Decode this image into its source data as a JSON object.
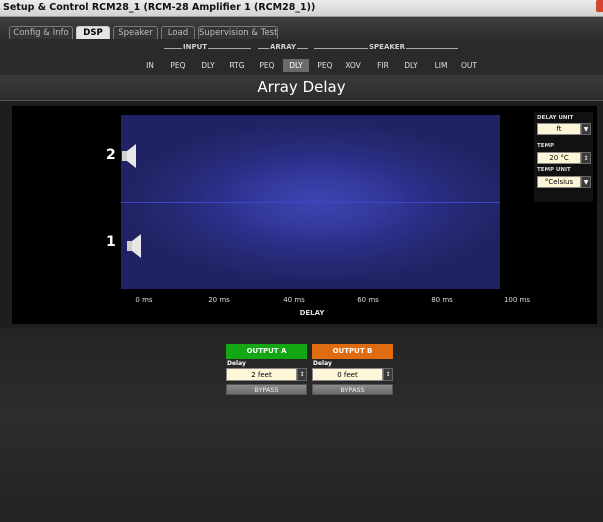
{
  "window": {
    "title": "Setup & Control RCM28_1 (RCM-28 Amplifier 1 (RCM28_1))"
  },
  "tabs": [
    {
      "label": "Config & Info",
      "active": false
    },
    {
      "label": "DSP",
      "active": true
    },
    {
      "label": "Speaker",
      "active": false
    },
    {
      "label": "Load",
      "active": false
    },
    {
      "label": "Supervision & Test",
      "active": false
    }
  ],
  "signal_chain": {
    "groups": {
      "input": "INPUT",
      "array": "ARRAY",
      "speaker": "SPEAKER"
    },
    "stages": [
      "IN",
      "PEQ",
      "DLY",
      "RTG",
      "PEQ",
      "DLY",
      "PEQ",
      "XOV",
      "FIR",
      "DLY",
      "LIM",
      "OUT"
    ],
    "active_index": 5
  },
  "page": {
    "title": "Array Delay"
  },
  "plot": {
    "speaker_labels": [
      "2",
      "1"
    ],
    "x_ticks": [
      "0 ms",
      "20 ms",
      "40 ms",
      "60 ms",
      "80 ms",
      "100 ms"
    ],
    "x_label": "DELAY",
    "colors": {
      "field": "#2a2e86",
      "center_line": "#3a48c8"
    }
  },
  "side_panel": {
    "delay_unit_label": "DELAY UNIT",
    "delay_unit_value": "ft",
    "temp_label": "TEMP",
    "temp_value": "20 °C",
    "temp_unit_label": "TEMP UNIT",
    "temp_unit_value": "°Celsius"
  },
  "outputs": [
    {
      "name": "OUTPUT A",
      "delay_label": "Delay",
      "delay_value": "2 feet",
      "bypass_label": "BYPASS",
      "color": "#13a813"
    },
    {
      "name": "OUTPUT B",
      "delay_label": "Delay",
      "delay_value": "0 feet",
      "bypass_label": "BYPASS",
      "color": "#e06c12"
    }
  ]
}
